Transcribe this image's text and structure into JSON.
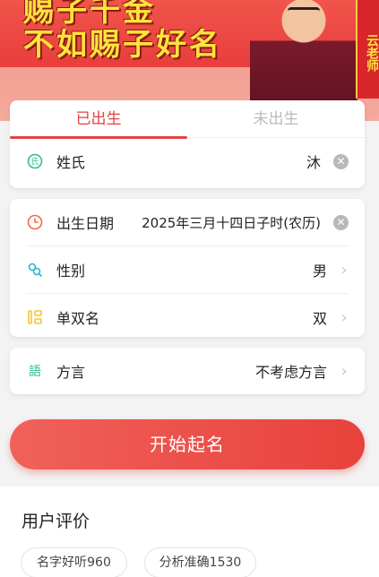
{
  "banner": {
    "slogan_line1": "赐子千金",
    "slogan_line2": "不如赐子好名",
    "vertical_tag": "云老师"
  },
  "tabs": {
    "born": "已出生",
    "unborn": "未出生"
  },
  "surname": {
    "label": "姓氏",
    "value": "沐",
    "icon": "surname-icon"
  },
  "birth_date": {
    "label": "出生日期",
    "value": "2025年三月十四日子时(农历)",
    "icon": "clock-icon"
  },
  "gender": {
    "label": "性别",
    "value": "男",
    "icon": "gender-icon"
  },
  "name_length": {
    "label": "单双名",
    "value": "双",
    "icon": "name-length-icon"
  },
  "dialect": {
    "label": "方言",
    "value": "不考虑方言",
    "icon": "dialect-icon"
  },
  "start_button": "开始起名",
  "reviews": {
    "title": "用户评价",
    "chips": [
      "名字好听960",
      "分析准确1530"
    ]
  },
  "colors": {
    "accent": "#e64141",
    "green_icon": "#2fbf8a",
    "orange_icon": "#f06a4a",
    "teal_icon": "#27b7c9",
    "yellow_icon": "#f5c431"
  }
}
